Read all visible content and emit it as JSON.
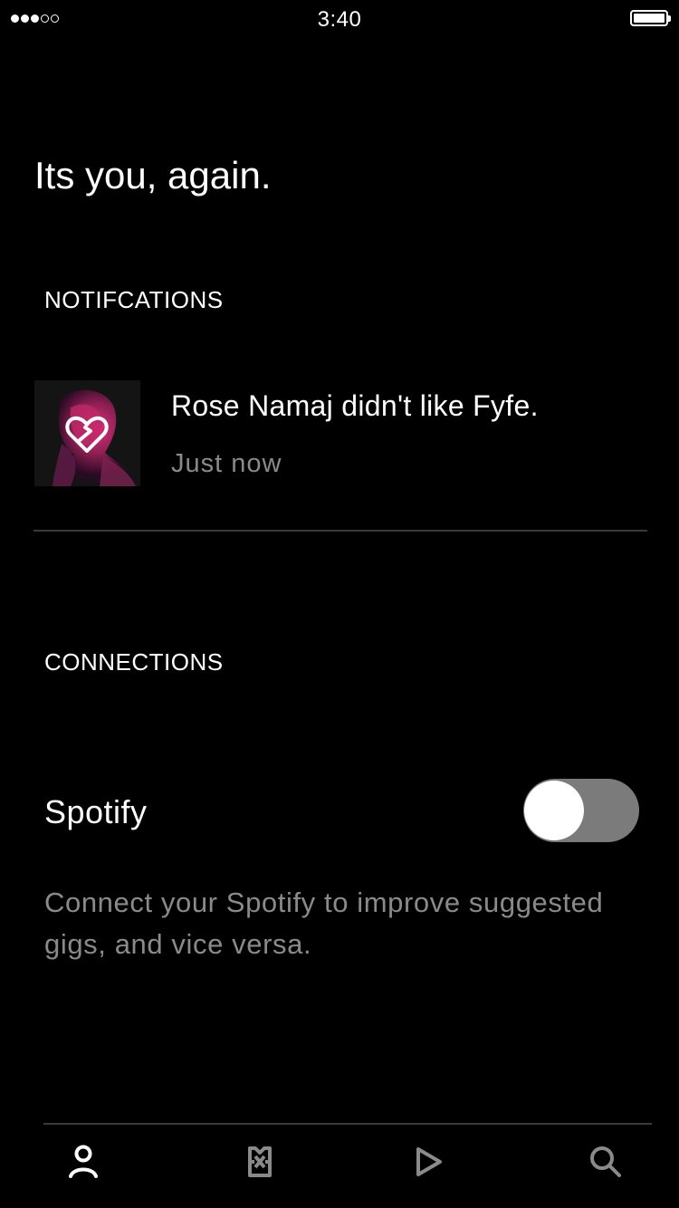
{
  "status_bar": {
    "time": "3:40",
    "signal_bars_filled": 3,
    "signal_bars_total": 5,
    "battery_level": 1.0
  },
  "page": {
    "title": "Its you, again."
  },
  "notifications": {
    "heading": "NOTIFCATIONS",
    "items": [
      {
        "text": "Rose Namaj didn't like Fyfe.",
        "time": "Just now",
        "thumbnail_icon": "broken-heart-icon"
      }
    ]
  },
  "connections": {
    "heading": "CONNECTIONS",
    "items": [
      {
        "name": "Spotify",
        "enabled": false,
        "description": "Connect your Spotify to improve suggested gigs, and vice versa."
      }
    ]
  },
  "tab_bar": {
    "tabs": [
      {
        "icon": "person-icon",
        "active": true
      },
      {
        "icon": "ticket-icon",
        "active": false
      },
      {
        "icon": "play-icon",
        "active": false
      },
      {
        "icon": "search-icon",
        "active": false
      }
    ],
    "active_color": "#ffffff",
    "inactive_color": "#8a8a8a"
  },
  "colors": {
    "background": "#000000",
    "secondary_text": "#8a8a8a",
    "divider": "#3a3a3a",
    "toggle_track": "#7b7b7b"
  }
}
